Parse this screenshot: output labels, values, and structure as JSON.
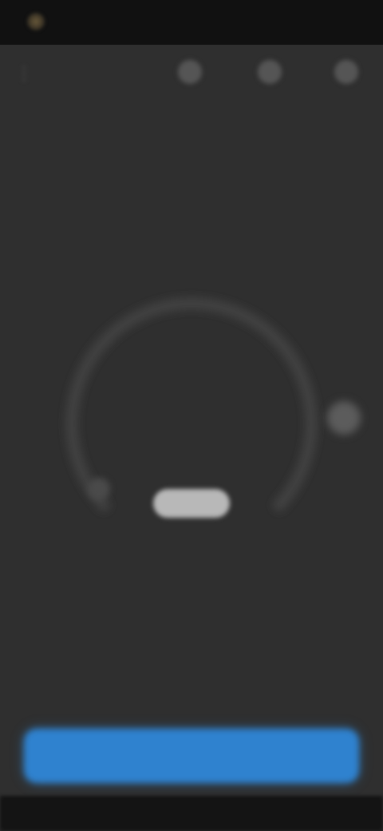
{
  "status_bar": {
    "app_text": "",
    "logo_icon": "app-logo-icon"
  },
  "top_bar": {
    "menu_icon": "menu-icon",
    "actions": [
      {
        "icon": "action-icon-1"
      },
      {
        "icon": "action-icon-2"
      },
      {
        "icon": "action-icon-3"
      }
    ]
  },
  "dial": {
    "label": "",
    "value": "",
    "unit": ""
  },
  "primary_button": {
    "label": ""
  },
  "colors": {
    "background": "#2f2f2f",
    "accent": "#2f82cf",
    "status_bar": "#111111"
  }
}
